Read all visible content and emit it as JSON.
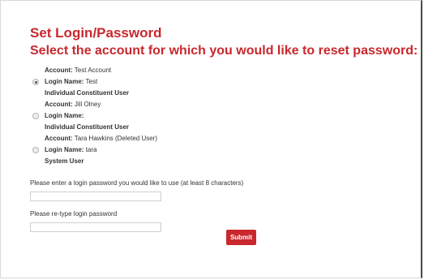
{
  "page": {
    "title": "Set Login/Password",
    "subtitle": "Select the account for which you would like to reset password:"
  },
  "accounts": [
    {
      "account_label": "Account:",
      "account_name": "Test Account",
      "login_label": "Login Name:",
      "login_name": "Test",
      "user_type": "Individual Constituent User",
      "selected": true
    },
    {
      "account_label": "Account:",
      "account_name": "Jill Olney",
      "login_label": "Login Name:",
      "login_name": "",
      "user_type": "Individual Constituent User",
      "selected": false
    },
    {
      "account_label": "Account:",
      "account_name": "Tara Hawkins (Deleted User)",
      "login_label": "Login Name:",
      "login_name": "tara",
      "user_type": "System User",
      "selected": false
    }
  ],
  "form": {
    "password_label": "Please enter a login password you would like to use (at least 8 characters)",
    "password_value": "",
    "retype_label": "Please re-type login password",
    "retype_value": "",
    "submit_label": "Submit"
  },
  "colors": {
    "accent": "#c8282e"
  }
}
